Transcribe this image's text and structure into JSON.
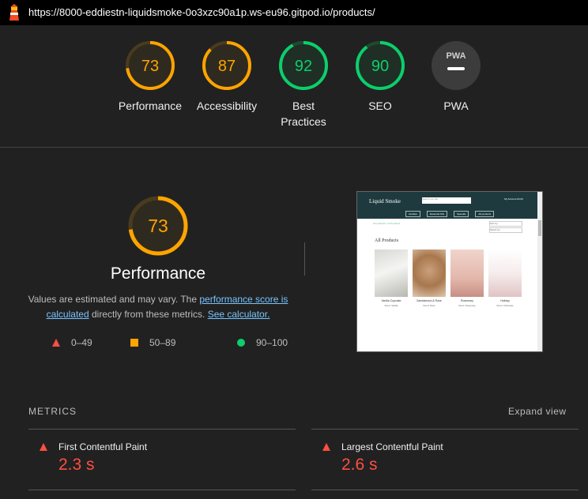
{
  "browser": {
    "url": "https://8000-eddiestn-liquidsmoke-0o3xzc90a1p.ws-eu96.gitpod.io/products/"
  },
  "colors": {
    "pass": "#0cce6b",
    "average": "#ffa400",
    "fail": "#ff4e42",
    "link": "#78c4ff"
  },
  "gauges": [
    {
      "score": "73",
      "label": "Performance"
    },
    {
      "score": "87",
      "label": "Accessibility"
    },
    {
      "score": "92",
      "label": "Best",
      "label2": "Practices"
    },
    {
      "score": "90",
      "label": "SEO"
    },
    {
      "score": "PWA",
      "label": "PWA"
    }
  ],
  "performance": {
    "score": "73",
    "title": "Performance",
    "desc_prefix": "Values are estimated and may vary. The ",
    "desc_link1": "performance score is calculated",
    "desc_mid": " directly from these metrics. ",
    "desc_link2": "See calculator."
  },
  "legend": {
    "fail": "0–49",
    "average": "50–89",
    "pass": "90–100"
  },
  "screenshot": {
    "brand": "Liquid Smoke",
    "search_placeholder": "Search our site",
    "account": "My Account",
    "bag": "£0.00",
    "menu": [
      "Candles",
      "Essential Oils",
      "Specials",
      "All products"
    ],
    "breadcrumb": "All products | 12 Products",
    "sort": "Sort by...",
    "sort2": "Select by...",
    "heading": "All Products",
    "cards": [
      {
        "name": "Vanilla Cupcake",
        "sub": "Scent: Vanilla"
      },
      {
        "name": "Sandalwood & Rose",
        "sub": "Scent: Rose"
      },
      {
        "name": "Rosemary",
        "sub": "Scent: Rosemary"
      },
      {
        "name": "Holiday",
        "sub": "Scent: Christmas"
      }
    ]
  },
  "metrics": {
    "heading": "METRICS",
    "expand": "Expand view",
    "items": [
      {
        "name": "First Contentful Paint",
        "value": "2.3 s"
      },
      {
        "name": "Largest Contentful Paint",
        "value": "2.6 s"
      }
    ]
  }
}
